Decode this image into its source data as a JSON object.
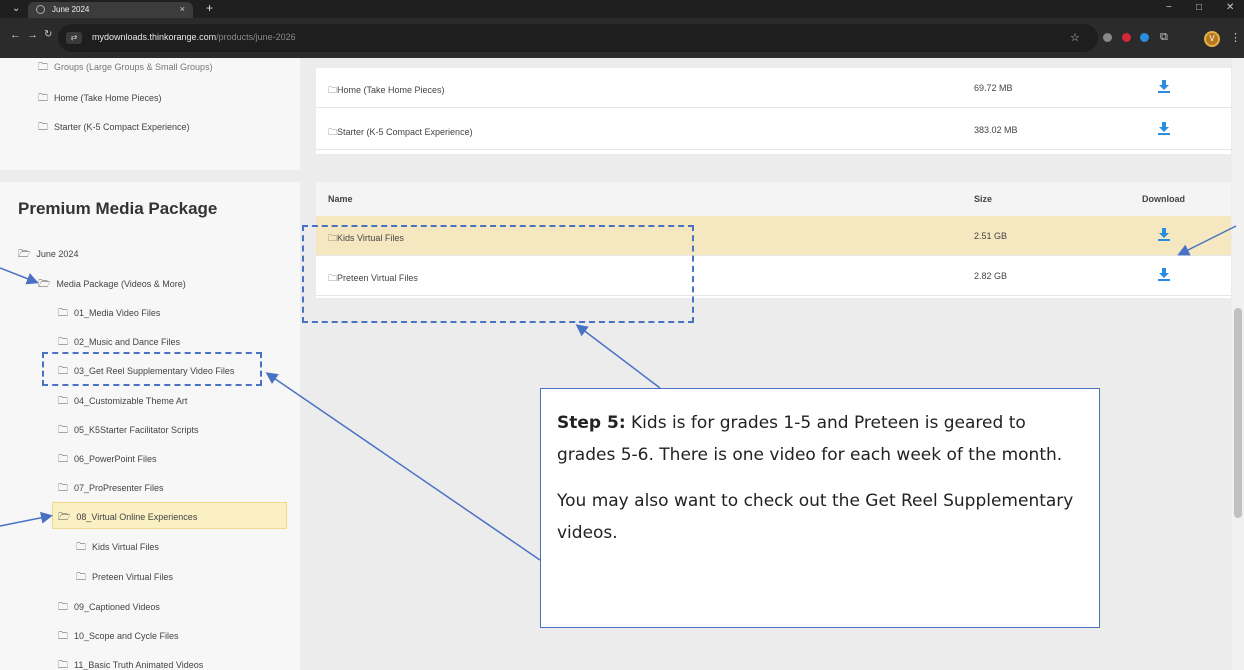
{
  "browser": {
    "tab_title": "June 2024",
    "tab_close": "×",
    "new_tab": "+",
    "menu_glyph": "⌄",
    "url_host": "mydownloads.thinkorange.com",
    "url_path": "/products/june-2026",
    "avatar_letter": "V",
    "minimize": "−",
    "maximize": "□",
    "close": "✕"
  },
  "top_sidebar": {
    "items": [
      {
        "label": "Groups (Large Groups & Small Groups)"
      },
      {
        "label": "Home (Take Home Pieces)"
      },
      {
        "label": "Starter (K-5 Compact Experience)"
      }
    ]
  },
  "top_table": {
    "rows": [
      {
        "name": "Home (Take Home Pieces)",
        "size": "69.72 MB"
      },
      {
        "name": "Starter (K-5 Compact Experience)",
        "size": "383.02 MB"
      }
    ]
  },
  "premium": {
    "title": "Premium Media Package",
    "tree": [
      {
        "label": "June 2024"
      },
      {
        "label": "Media Package (Videos & More)"
      },
      {
        "label": "01_Media Video Files"
      },
      {
        "label": "02_Music and Dance Files"
      },
      {
        "label": "03_Get Reel Supplementary Video Files"
      },
      {
        "label": "04_Customizable Theme Art"
      },
      {
        "label": "05_K5Starter Facilitator Scripts"
      },
      {
        "label": "06_PowerPoint Files"
      },
      {
        "label": "07_ProPresenter Files"
      },
      {
        "label": "08_Virtual Online Experiences"
      },
      {
        "label": "Kids Virtual Files"
      },
      {
        "label": "Preteen Virtual Files"
      },
      {
        "label": "09_Captioned Videos"
      },
      {
        "label": "10_Scope and Cycle Files"
      },
      {
        "label": "11_Basic Truth Animated Videos"
      }
    ]
  },
  "main_table": {
    "headers": {
      "name": "Name",
      "size": "Size",
      "download": "Download"
    },
    "rows": [
      {
        "name": "Kids Virtual Files",
        "size": "2.51 GB"
      },
      {
        "name": "Preteen Virtual Files",
        "size": "2.82 GB"
      }
    ]
  },
  "callout": {
    "step_label": "Step 5:",
    "line1": " Kids is for grades 1-5 and Preteen is geared to grades 5-6. There is one video for each week of the month.",
    "line2": "You may also want to check out the Get Reel Supplementary videos."
  },
  "colors": {
    "accent": "#2c8ce0",
    "annotation": "#4a72c4",
    "selected_row": "#f5e8c1"
  }
}
